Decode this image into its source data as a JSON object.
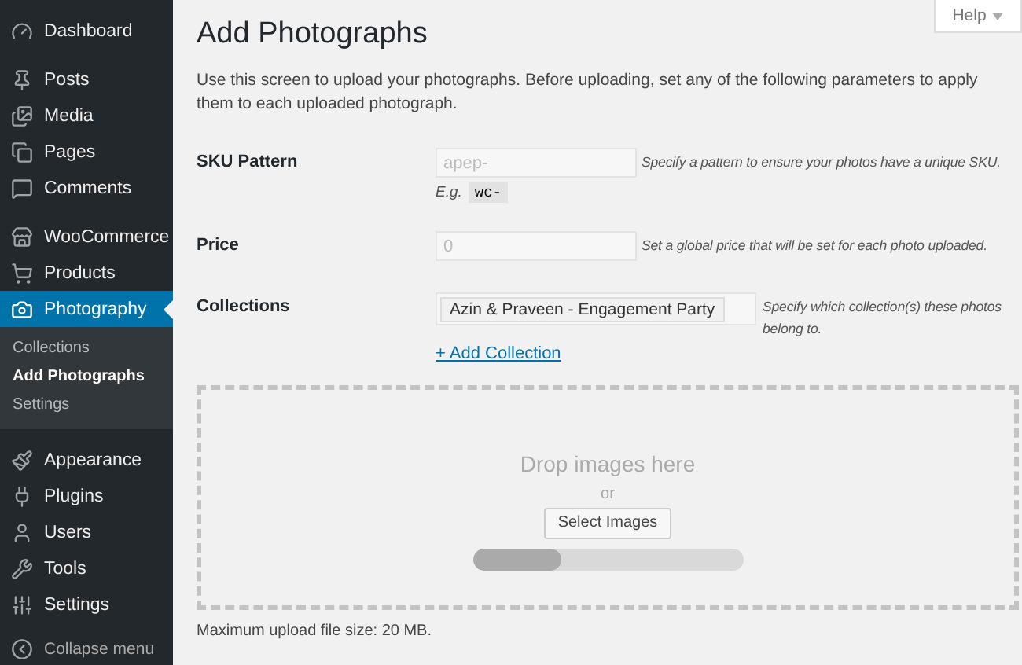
{
  "sidebar": {
    "groups": [
      [
        {
          "label": "Dashboard",
          "selected": false
        }
      ],
      [
        {
          "label": "Posts",
          "selected": false
        },
        {
          "label": "Media",
          "selected": false
        },
        {
          "label": "Pages",
          "selected": false
        },
        {
          "label": "Comments",
          "selected": false
        }
      ],
      [
        {
          "label": "WooCommerce",
          "selected": false
        },
        {
          "label": "Products",
          "selected": false
        },
        {
          "label": "Photography",
          "selected": true,
          "children": [
            {
              "label": "Collections",
              "selected": false
            },
            {
              "label": "Add Photographs",
              "selected": true
            },
            {
              "label": "Settings",
              "selected": false
            }
          ]
        }
      ],
      [
        {
          "label": "Appearance",
          "selected": false
        },
        {
          "label": "Plugins",
          "selected": false
        },
        {
          "label": "Users",
          "selected": false
        },
        {
          "label": "Tools",
          "selected": false
        },
        {
          "label": "Settings",
          "selected": false
        }
      ]
    ],
    "collapse": "Collapse menu"
  },
  "help_tab": {
    "label": "Help",
    "expanded": false
  },
  "page": {
    "title": "Add Photographs",
    "description": "Use this screen to upload your photographs. Before uploading, set any of the following parameters to apply them to each uploaded photograph."
  },
  "fields": [
    {
      "kind": "text",
      "label": "SKU Pattern",
      "placeholder": "apep-",
      "hint": "Specify a pattern to ensure your photos have a unique SKU.",
      "example_label": "E.g.",
      "example_code": "wc-"
    },
    {
      "kind": "text",
      "label": "Price",
      "placeholder": "0",
      "hint": "Set a global price that will be set for each photo uploaded."
    },
    {
      "kind": "tags",
      "label": "Collections",
      "tags": [
        "Azin & Praveen - Engagement Party"
      ],
      "hint": "Specify which collection(s) these photos belong to.",
      "link": "+ Add Collection"
    }
  ],
  "uploader": {
    "drop_text": "Drop images here",
    "or_text": "or",
    "button": "Select Images",
    "progress": {
      "level": 0.33
    },
    "max_size": "Maximum upload file size: 20 MB."
  }
}
